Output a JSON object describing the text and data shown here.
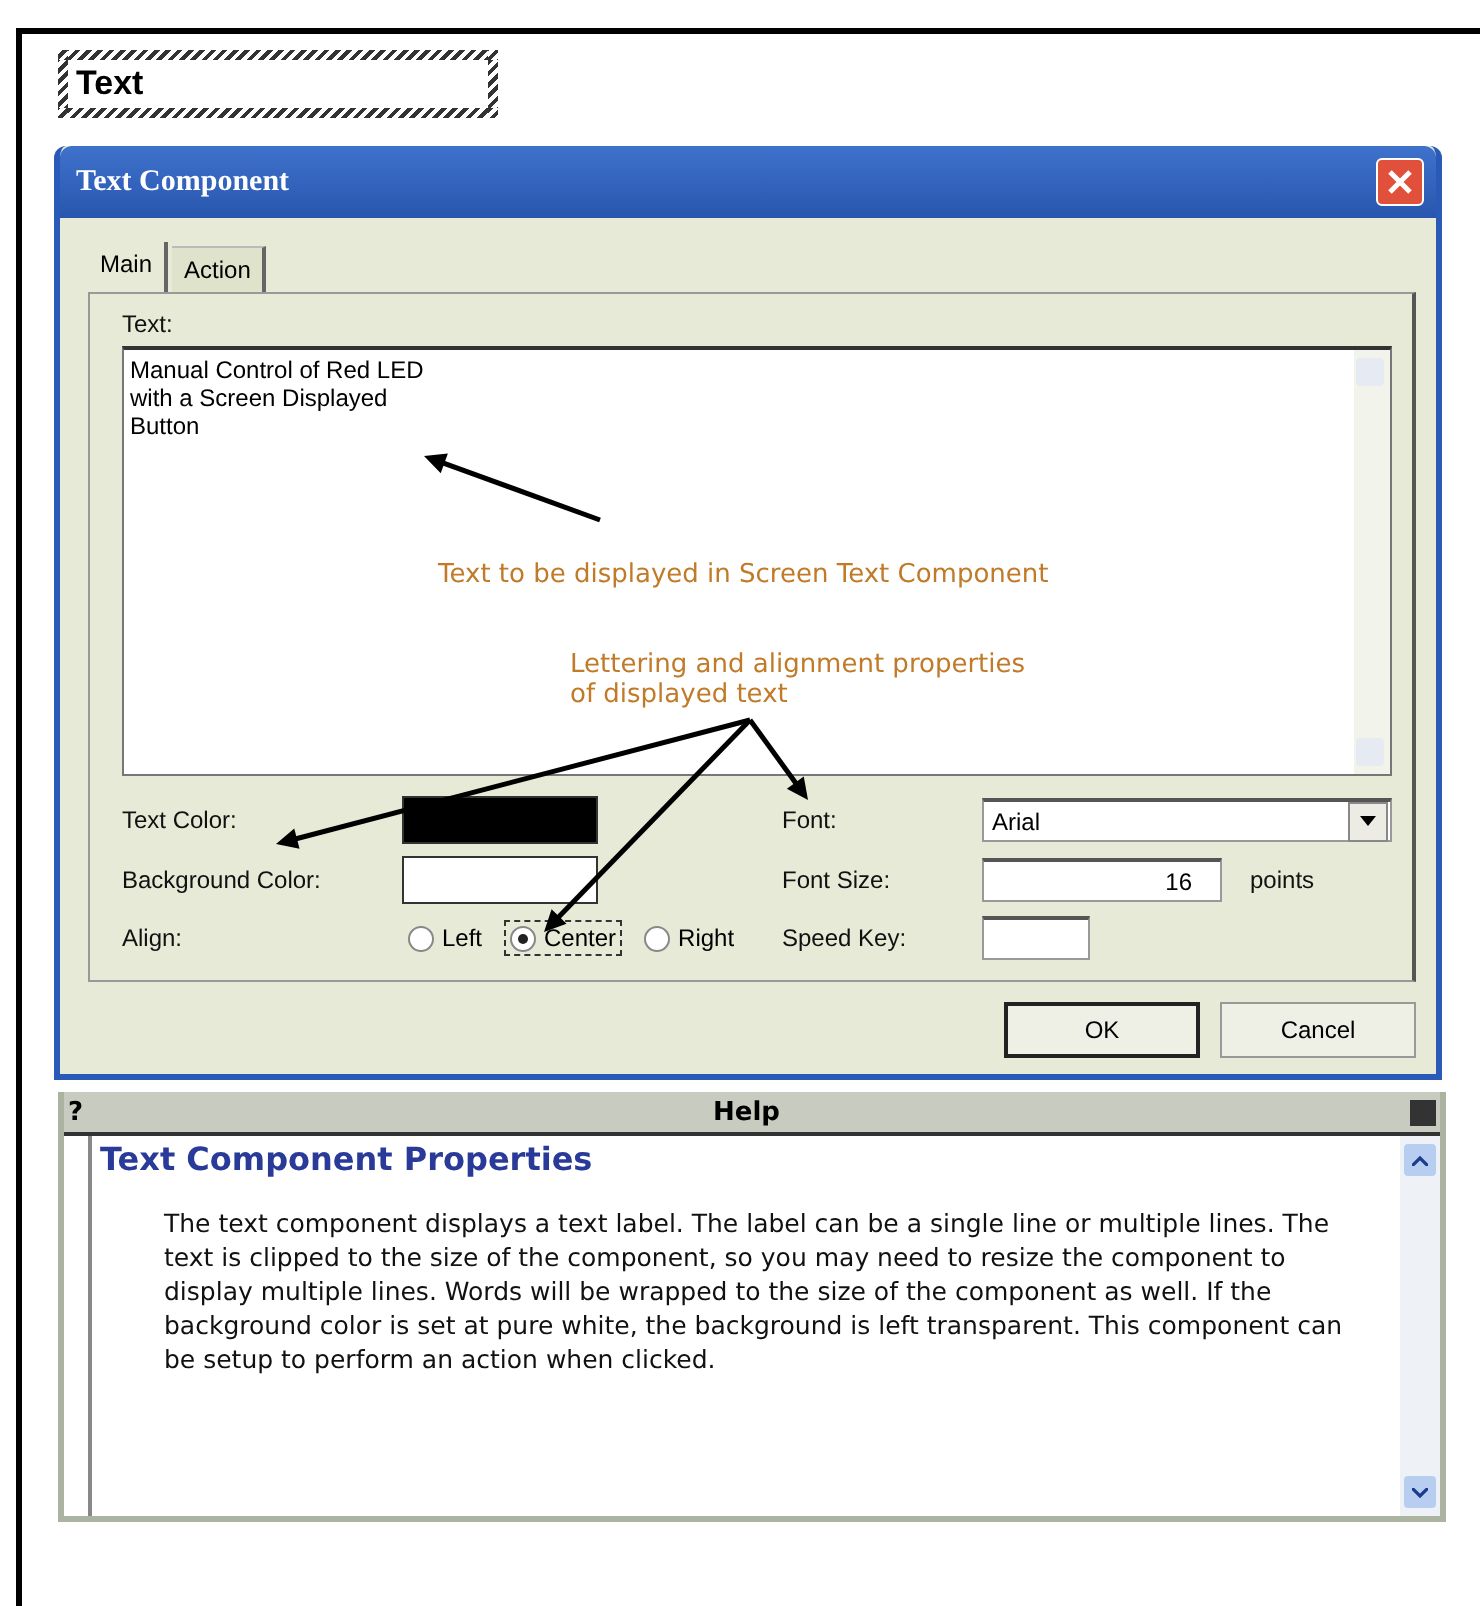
{
  "canvas_component": {
    "label": "Text"
  },
  "dialog": {
    "title": "Text Component",
    "tabs": [
      {
        "label": "Main",
        "selected": true
      },
      {
        "label": "Action",
        "selected": false
      }
    ],
    "text_label": "Text:",
    "text_value": "Manual Control of Red LED\nwith a Screen Displayed\nButton",
    "annotations": [
      {
        "text": "Text to be displayed in Screen Text Component"
      },
      {
        "text": "Lettering and alignment properties\nof displayed text"
      }
    ],
    "text_color": {
      "label": "Text Color:",
      "color": "#000000"
    },
    "background_color": {
      "label": "Background Color:",
      "color": "#ffffff"
    },
    "align": {
      "label": "Align:",
      "options": [
        {
          "label": "Left",
          "selected": false
        },
        {
          "label": "Center",
          "selected": true
        },
        {
          "label": "Right",
          "selected": false
        }
      ]
    },
    "font": {
      "label": "Font:",
      "value": "Arial"
    },
    "font_size": {
      "label": "Font Size:",
      "value": "16",
      "unit": "points"
    },
    "speed_key": {
      "label": "Speed Key:"
    },
    "buttons": [
      "OK",
      "Cancel"
    ]
  },
  "help": {
    "help_mark": "?",
    "title": "Help",
    "heading": "Text Component Properties",
    "body": "The text component displays a text label.  The label can be a single line or multiple lines.  The text is clipped to the size of the component, so you may need to resize the component to display multiple lines.  Words will be wrapped to the size of the component as well.  If the background color is set at pure white, the background is left transparent.  This component can be setup to perform an action when clicked."
  }
}
